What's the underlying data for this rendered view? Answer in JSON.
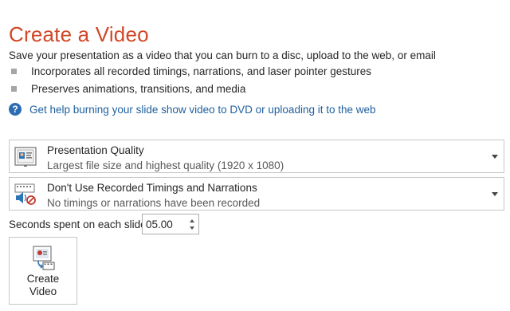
{
  "header": {
    "title": "Create a Video",
    "description": "Save your presentation as a video that you can burn to a disc, upload to the web, or email"
  },
  "bullets": [
    "Incorporates all recorded timings, narrations, and laser pointer gestures",
    "Preserves animations, transitions, and media"
  ],
  "help_link": "Get help burning your slide show video to DVD or uploading it to the web",
  "quality_dropdown": {
    "title": "Presentation Quality",
    "subtitle": "Largest file size and highest quality (1920 x 1080)",
    "icon": "presentation-quality-icon"
  },
  "timings_dropdown": {
    "title": "Don't Use Recorded Timings and Narrations",
    "subtitle": "No timings or narrations have been recorded",
    "icon": "no-narration-icon"
  },
  "seconds": {
    "label": "Seconds spent on each slide:",
    "value": "05.00"
  },
  "create_button": {
    "line1": "Create",
    "line2": "Video",
    "icon": "create-video-icon"
  },
  "colors": {
    "title": "#d24726",
    "link": "#1f5f9e",
    "help_icon": "#2b6cb3"
  }
}
